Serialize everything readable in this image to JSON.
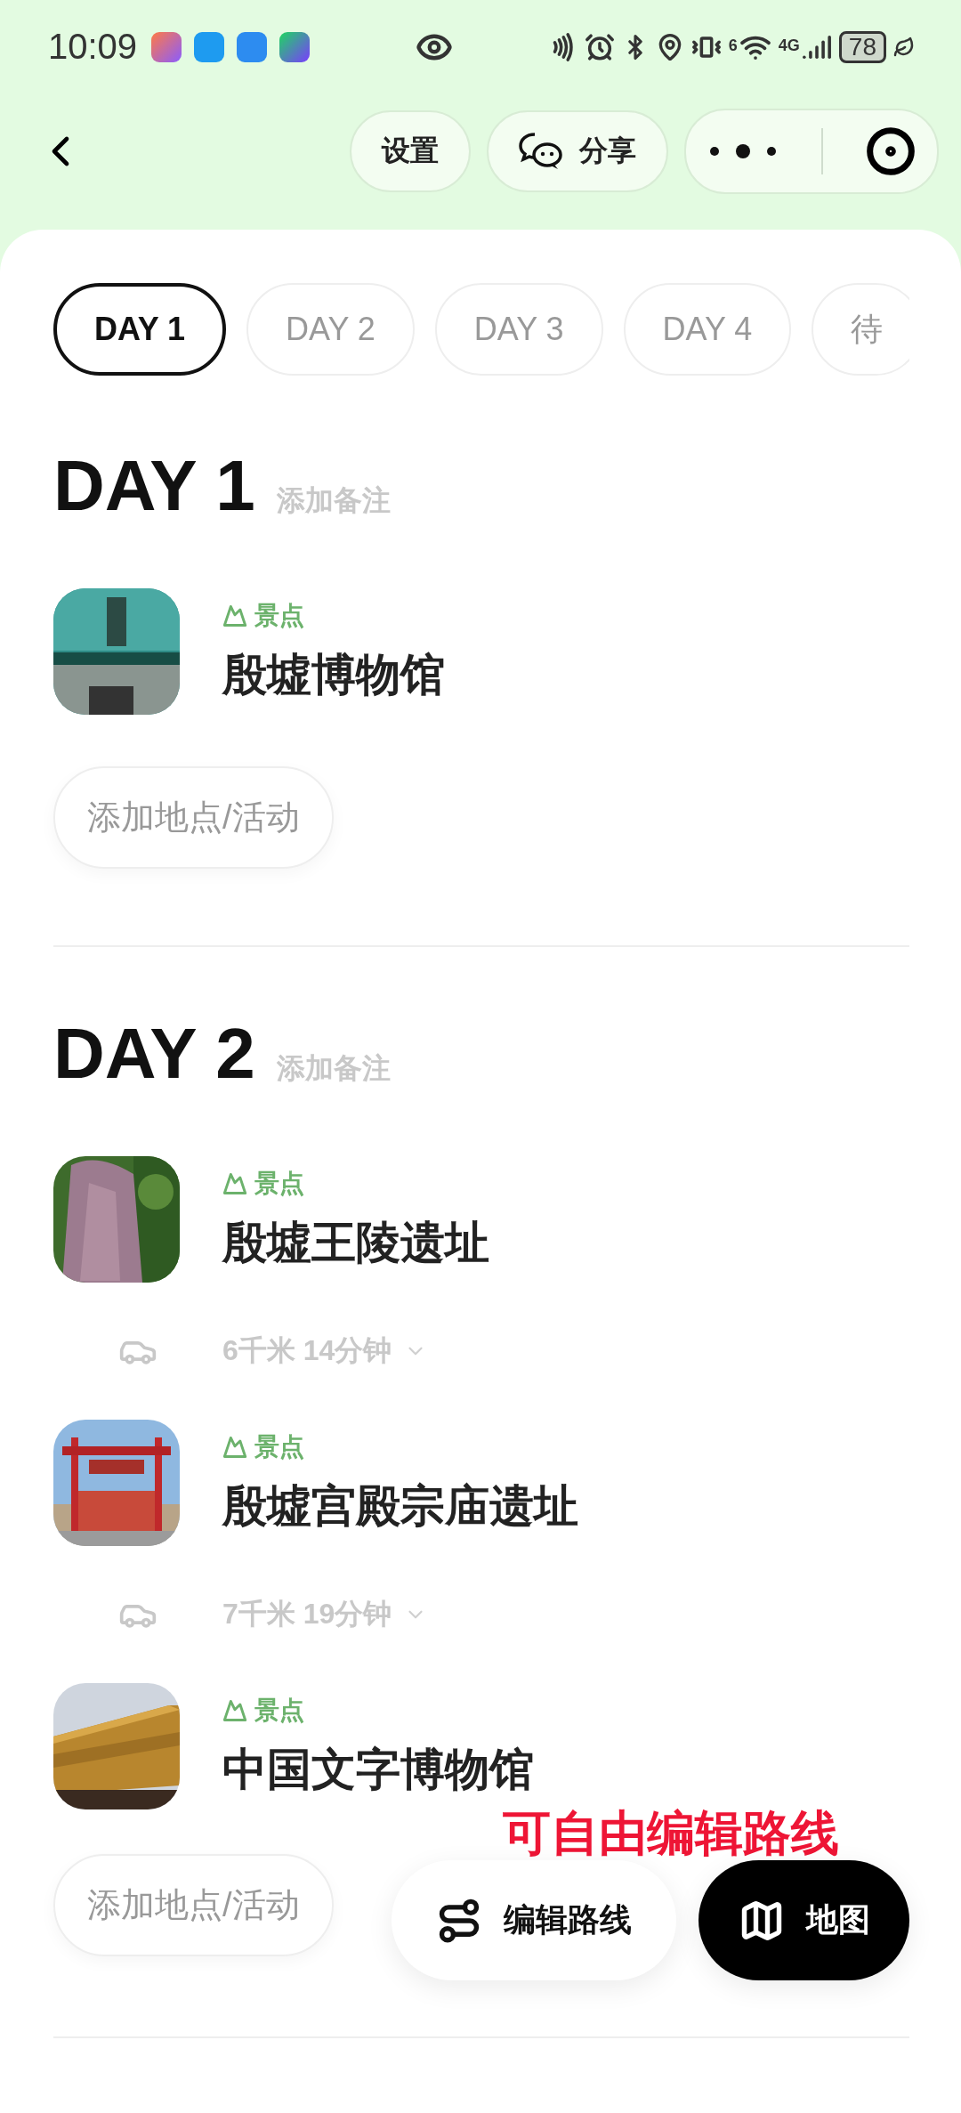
{
  "status_bar": {
    "time": "10:09",
    "wifi": "6",
    "network": "4G",
    "battery": "78"
  },
  "nav": {
    "buttons": [
      "设置",
      "分享"
    ]
  },
  "tabs": [
    {
      "label": "DAY 1",
      "selected": true
    },
    {
      "label": "DAY 2",
      "selected": false
    },
    {
      "label": "DAY 3",
      "selected": false
    },
    {
      "label": "DAY 4",
      "selected": false
    },
    {
      "label": "待",
      "selected": false
    }
  ],
  "days": [
    {
      "title": "DAY 1",
      "note_placeholder": "添加备注",
      "items": [
        {
          "kind": "place",
          "tag": "景点",
          "name": "殷墟博物馆"
        }
      ],
      "add_button": "添加地点/活动"
    },
    {
      "title": "DAY 2",
      "note_placeholder": "添加备注",
      "items": [
        {
          "kind": "place",
          "tag": "景点",
          "name": "殷墟王陵遗址"
        },
        {
          "kind": "route",
          "text": "6千米 14分钟"
        },
        {
          "kind": "place",
          "tag": "景点",
          "name": "殷墟宫殿宗庙遗址"
        },
        {
          "kind": "route",
          "text": "7千米 19分钟"
        },
        {
          "kind": "place",
          "tag": "景点",
          "name": "中国文字博物馆"
        }
      ],
      "add_button": "添加地点/活动"
    }
  ],
  "annotation": "可自由编辑路线",
  "floating": {
    "edit_button": "编辑路线",
    "map_button": "地图"
  }
}
